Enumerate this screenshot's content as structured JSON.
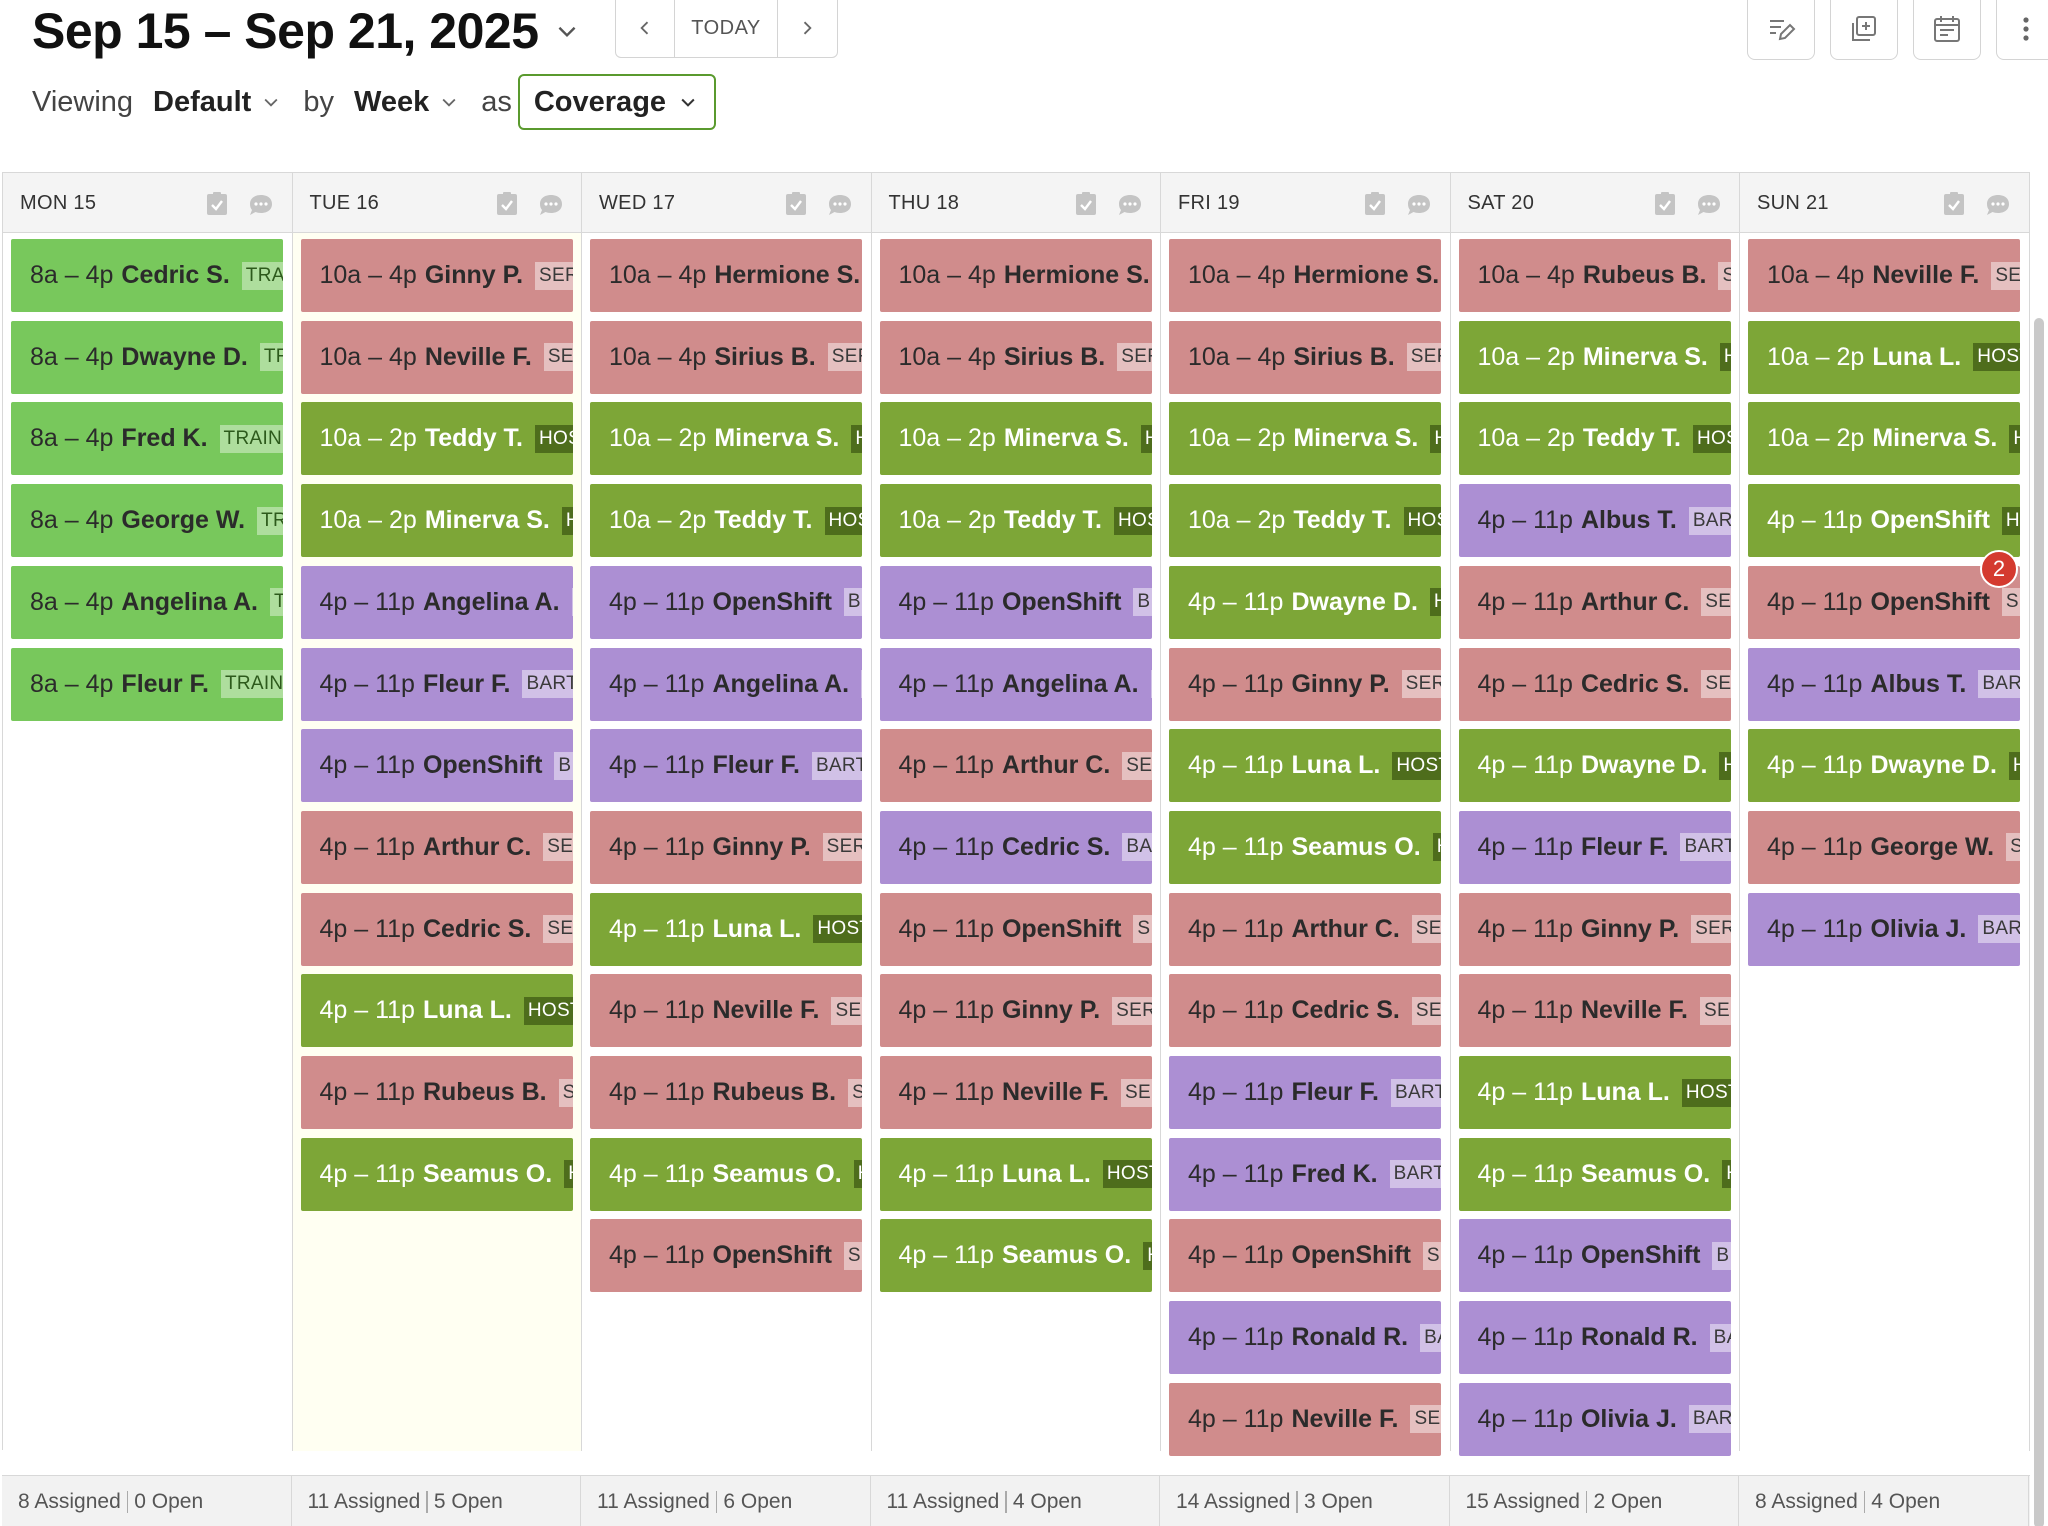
{
  "header": {
    "date_range": "Sep 15 – Sep 21, 2025",
    "today_label": "TODAY",
    "viewing_label": "Viewing",
    "viewing_value": "Default",
    "by_label": "by",
    "by_value": "Week",
    "as_label": "as",
    "as_value": "Coverage"
  },
  "colors": {
    "green_light": "#78c85c",
    "green_dark": "#7da637",
    "salmon": "#d08c8c",
    "purple": "#ac8fd3",
    "badge": "#d43a2f",
    "accent_border": "#5a9a2e"
  },
  "days": [
    {
      "name": "MON 15",
      "footer": {
        "assigned": "8 Assigned",
        "open": "0 Open"
      },
      "shifts": [
        {
          "time": "8a – 4p",
          "name": "Cedric S.",
          "tag": "TRAIN",
          "color": "green-light"
        },
        {
          "time": "8a – 4p",
          "name": "Dwayne D.",
          "tag": "TRA",
          "color": "green-light"
        },
        {
          "time": "8a – 4p",
          "name": "Fred K.",
          "tag": "TRAININ",
          "color": "green-light"
        },
        {
          "time": "8a – 4p",
          "name": "George W.",
          "tag": "TRA",
          "color": "green-light"
        },
        {
          "time": "8a – 4p",
          "name": "Angelina A.",
          "tag": "TR",
          "color": "green-light"
        },
        {
          "time": "8a – 4p",
          "name": "Fleur F.",
          "tag": "TRAINI",
          "color": "green-light"
        }
      ]
    },
    {
      "name": "TUE 16",
      "footer": {
        "assigned": "11 Assigned",
        "open": "5 Open"
      },
      "shifts": [
        {
          "time": "10a – 4p",
          "name": "Ginny P.",
          "tag": "SERV",
          "color": "salmon"
        },
        {
          "time": "10a – 4p",
          "name": "Neville F.",
          "tag": "SER",
          "color": "salmon"
        },
        {
          "time": "10a – 2p",
          "name": "Teddy T.",
          "tag": "HOS",
          "color": "green-dark"
        },
        {
          "time": "10a – 2p",
          "name": "Minerva S.",
          "tag": "H",
          "color": "green-dark"
        },
        {
          "time": "4p – 11p",
          "name": "Angelina A.",
          "tag": "E",
          "color": "purple"
        },
        {
          "time": "4p – 11p",
          "name": "Fleur F.",
          "tag": "BART",
          "color": "purple"
        },
        {
          "time": "4p – 11p",
          "name": "OpenShift",
          "tag": "B",
          "color": "purple"
        },
        {
          "time": "4p – 11p",
          "name": "Arthur C.",
          "tag": "SER",
          "color": "salmon"
        },
        {
          "time": "4p – 11p",
          "name": "Cedric S.",
          "tag": "SER",
          "color": "salmon"
        },
        {
          "time": "4p – 11p",
          "name": "Luna L.",
          "tag": "HOST",
          "color": "green-dark"
        },
        {
          "time": "4p – 11p",
          "name": "Rubeus B.",
          "tag": "SE",
          "color": "salmon"
        },
        {
          "time": "4p – 11p",
          "name": "Seamus O.",
          "tag": "H",
          "color": "green-dark"
        }
      ]
    },
    {
      "name": "WED 17",
      "footer": {
        "assigned": "11 Assigned",
        "open": "6 Open"
      },
      "shifts": [
        {
          "time": "10a – 4p",
          "name": "Hermione S.",
          "tag": "",
          "color": "salmon"
        },
        {
          "time": "10a – 4p",
          "name": "Sirius B.",
          "tag": "SER",
          "color": "salmon"
        },
        {
          "time": "10a – 2p",
          "name": "Minerva S.",
          "tag": "H",
          "color": "green-dark"
        },
        {
          "time": "10a – 2p",
          "name": "Teddy T.",
          "tag": "HOS",
          "color": "green-dark"
        },
        {
          "time": "4p – 11p",
          "name": "OpenShift",
          "tag": "B",
          "color": "purple"
        },
        {
          "time": "4p – 11p",
          "name": "Angelina A.",
          "tag": "E",
          "color": "purple"
        },
        {
          "time": "4p – 11p",
          "name": "Fleur F.",
          "tag": "BART",
          "color": "purple"
        },
        {
          "time": "4p – 11p",
          "name": "Ginny P.",
          "tag": "SER",
          "color": "salmon"
        },
        {
          "time": "4p – 11p",
          "name": "Luna L.",
          "tag": "HOST",
          "color": "green-dark"
        },
        {
          "time": "4p – 11p",
          "name": "Neville F.",
          "tag": "SER",
          "color": "salmon"
        },
        {
          "time": "4p – 11p",
          "name": "Rubeus B.",
          "tag": "SE",
          "color": "salmon"
        },
        {
          "time": "4p – 11p",
          "name": "Seamus O.",
          "tag": "H",
          "color": "green-dark"
        },
        {
          "time": "4p – 11p",
          "name": "OpenShift",
          "tag": "S",
          "color": "salmon"
        }
      ]
    },
    {
      "name": "THU 18",
      "footer": {
        "assigned": "11 Assigned",
        "open": "4 Open"
      },
      "shifts": [
        {
          "time": "10a – 4p",
          "name": "Hermione S.",
          "tag": "",
          "color": "salmon"
        },
        {
          "time": "10a – 4p",
          "name": "Sirius B.",
          "tag": "SER",
          "color": "salmon"
        },
        {
          "time": "10a – 2p",
          "name": "Minerva S.",
          "tag": "H",
          "color": "green-dark"
        },
        {
          "time": "10a – 2p",
          "name": "Teddy T.",
          "tag": "HOS",
          "color": "green-dark"
        },
        {
          "time": "4p – 11p",
          "name": "OpenShift",
          "tag": "B",
          "color": "purple"
        },
        {
          "time": "4p – 11p",
          "name": "Angelina A.",
          "tag": "E",
          "color": "purple"
        },
        {
          "time": "4p – 11p",
          "name": "Arthur C.",
          "tag": "SER",
          "color": "salmon"
        },
        {
          "time": "4p – 11p",
          "name": "Cedric S.",
          "tag": "BAR",
          "color": "purple"
        },
        {
          "time": "4p – 11p",
          "name": "OpenShift",
          "tag": "S",
          "color": "salmon"
        },
        {
          "time": "4p – 11p",
          "name": "Ginny P.",
          "tag": "SER",
          "color": "salmon"
        },
        {
          "time": "4p – 11p",
          "name": "Neville F.",
          "tag": "SER",
          "color": "salmon"
        },
        {
          "time": "4p – 11p",
          "name": "Luna L.",
          "tag": "HOST",
          "color": "green-dark"
        },
        {
          "time": "4p – 11p",
          "name": "Seamus O.",
          "tag": "H",
          "color": "green-dark"
        }
      ]
    },
    {
      "name": "FRI 19",
      "footer": {
        "assigned": "14 Assigned",
        "open": "3 Open"
      },
      "shifts": [
        {
          "time": "10a – 4p",
          "name": "Hermione S.",
          "tag": "",
          "color": "salmon"
        },
        {
          "time": "10a – 4p",
          "name": "Sirius B.",
          "tag": "SER",
          "color": "salmon"
        },
        {
          "time": "10a – 2p",
          "name": "Minerva S.",
          "tag": "H",
          "color": "green-dark"
        },
        {
          "time": "10a – 2p",
          "name": "Teddy T.",
          "tag": "HOS",
          "color": "green-dark"
        },
        {
          "time": "4p – 11p",
          "name": "Dwayne D.",
          "tag": "H",
          "color": "green-dark"
        },
        {
          "time": "4p – 11p",
          "name": "Ginny P.",
          "tag": "SER",
          "color": "salmon"
        },
        {
          "time": "4p – 11p",
          "name": "Luna L.",
          "tag": "HOST",
          "color": "green-dark"
        },
        {
          "time": "4p – 11p",
          "name": "Seamus O.",
          "tag": "H",
          "color": "green-dark"
        },
        {
          "time": "4p – 11p",
          "name": "Arthur C.",
          "tag": "SER",
          "color": "salmon"
        },
        {
          "time": "4p – 11p",
          "name": "Cedric S.",
          "tag": "SER",
          "color": "salmon"
        },
        {
          "time": "4p – 11p",
          "name": "Fleur F.",
          "tag": "BART",
          "color": "purple"
        },
        {
          "time": "4p – 11p",
          "name": "Fred K.",
          "tag": "BART",
          "color": "purple"
        },
        {
          "time": "4p – 11p",
          "name": "OpenShift",
          "tag": "S",
          "color": "salmon"
        },
        {
          "time": "4p – 11p",
          "name": "Ronald R.",
          "tag": "BA",
          "color": "purple"
        },
        {
          "time": "4p – 11p",
          "name": "Neville F.",
          "tag": "SER",
          "color": "salmon"
        }
      ]
    },
    {
      "name": "SAT 20",
      "footer": {
        "assigned": "15 Assigned",
        "open": "2 Open"
      },
      "shifts": [
        {
          "time": "10a – 4p",
          "name": "Rubeus B.",
          "tag": "SE",
          "color": "salmon"
        },
        {
          "time": "10a – 2p",
          "name": "Minerva S.",
          "tag": "H",
          "color": "green-dark"
        },
        {
          "time": "10a – 2p",
          "name": "Teddy T.",
          "tag": "HOS",
          "color": "green-dark"
        },
        {
          "time": "4p – 11p",
          "name": "Albus T.",
          "tag": "BART",
          "color": "purple"
        },
        {
          "time": "4p – 11p",
          "name": "Arthur C.",
          "tag": "SER",
          "color": "salmon"
        },
        {
          "time": "4p – 11p",
          "name": "Cedric S.",
          "tag": "SER",
          "color": "salmon"
        },
        {
          "time": "4p – 11p",
          "name": "Dwayne D.",
          "tag": "H",
          "color": "green-dark"
        },
        {
          "time": "4p – 11p",
          "name": "Fleur F.",
          "tag": "BART",
          "color": "purple"
        },
        {
          "time": "4p – 11p",
          "name": "Ginny P.",
          "tag": "SER",
          "color": "salmon"
        },
        {
          "time": "4p – 11p",
          "name": "Neville F.",
          "tag": "SER",
          "color": "salmon"
        },
        {
          "time": "4p – 11p",
          "name": "Luna L.",
          "tag": "HOST",
          "color": "green-dark"
        },
        {
          "time": "4p – 11p",
          "name": "Seamus O.",
          "tag": "H",
          "color": "green-dark"
        },
        {
          "time": "4p – 11p",
          "name": "OpenShift",
          "tag": "B",
          "color": "purple"
        },
        {
          "time": "4p – 11p",
          "name": "Ronald R.",
          "tag": "BA",
          "color": "purple"
        },
        {
          "time": "4p – 11p",
          "name": "Olivia J.",
          "tag": "BART",
          "color": "purple"
        }
      ]
    },
    {
      "name": "SUN 21",
      "footer": {
        "assigned": "8 Assigned",
        "open": "4 Open"
      },
      "shifts": [
        {
          "time": "10a – 4p",
          "name": "Neville F.",
          "tag": "SER",
          "color": "salmon"
        },
        {
          "time": "10a – 2p",
          "name": "Luna L.",
          "tag": "HOST",
          "color": "green-dark"
        },
        {
          "time": "10a – 2p",
          "name": "Minerva S.",
          "tag": "H",
          "color": "green-dark"
        },
        {
          "time": "4p – 11p",
          "name": "OpenShift",
          "tag": "H",
          "color": "green-dark"
        },
        {
          "time": "4p – 11p",
          "name": "OpenShift",
          "tag": "S",
          "color": "salmon",
          "badge": "2"
        },
        {
          "time": "4p – 11p",
          "name": "Albus T.",
          "tag": "BART",
          "color": "purple"
        },
        {
          "time": "4p – 11p",
          "name": "Dwayne D.",
          "tag": "H",
          "color": "green-dark"
        },
        {
          "time": "4p – 11p",
          "name": "George W.",
          "tag": "SE",
          "color": "salmon"
        },
        {
          "time": "4p – 11p",
          "name": "Olivia J.",
          "tag": "BART",
          "color": "purple"
        }
      ]
    }
  ]
}
